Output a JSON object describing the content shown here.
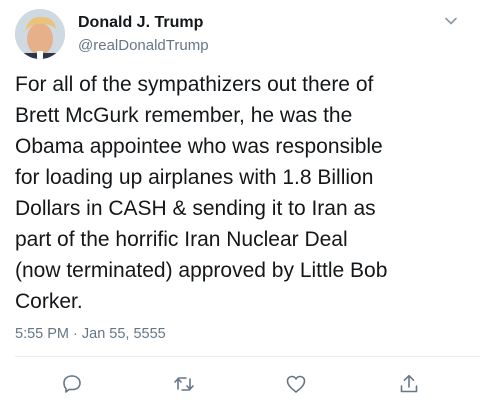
{
  "author": {
    "name": "Donald J. Trump",
    "handle": "@realDonaldTrump"
  },
  "tweet": {
    "lines": [
      "For all of the sympathizers out there of",
      "Brett McGurk remember, he was the",
      "Obama appointee who was responsible",
      "for loading up airplanes with 1.8 Billion",
      "Dollars in CASH & sending it to Iran as",
      "part of the horrific Iran Nuclear Deal",
      "(now terminated) approved by Little Bob",
      "Corker."
    ],
    "timestamp": "5:55 PM · Jan 55, 5555"
  },
  "icons": {
    "menu": "chevron-down-icon",
    "reply": "reply-icon",
    "retweet": "retweet-icon",
    "like": "heart-icon",
    "share": "share-icon"
  },
  "colors": {
    "text": "#14171a",
    "secondary": "#657786",
    "icon": "#657786",
    "divider": "#e6ecf0"
  }
}
